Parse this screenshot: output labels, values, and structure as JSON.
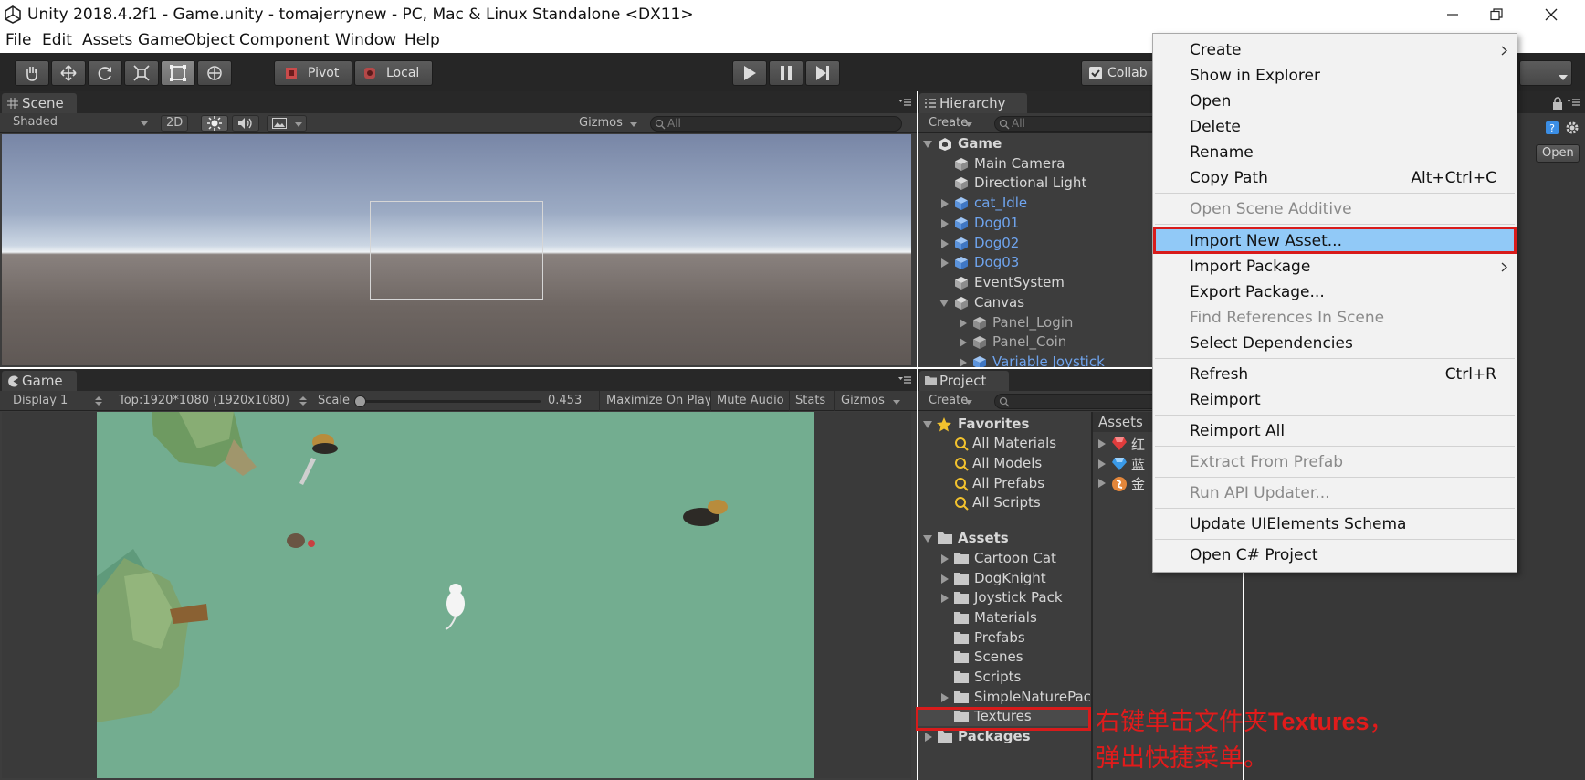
{
  "window": {
    "title": "Unity 2018.4.2f1 - Game.unity - tomajerrynew - PC, Mac & Linux Standalone <DX11>"
  },
  "menubar": [
    "File",
    "Edit",
    "Assets",
    "GameObject",
    "Component",
    "Window",
    "Help"
  ],
  "toolbar": {
    "pivot_label": "Pivot",
    "local_label": "Local",
    "collab_label": "Collab"
  },
  "scene": {
    "tab": "Scene",
    "shading": "Shaded",
    "mode_2d": "2D",
    "gizmos": "Gizmos",
    "search_placeholder": "All"
  },
  "game": {
    "tab": "Game",
    "display": "Display 1",
    "resolution": "Top:1920*1080 (1920x1080)",
    "scale_label": "Scale",
    "scale_value": "0.453",
    "maximize": "Maximize On Play",
    "mute": "Mute Audio",
    "stats": "Stats",
    "gizmos": "Gizmos"
  },
  "hierarchy": {
    "tab": "Hierarchy",
    "create": "Create",
    "search_placeholder": "All",
    "scene_name": "Game",
    "items": [
      {
        "label": "Main Camera"
      },
      {
        "label": "Directional Light"
      },
      {
        "label": "cat_Idle"
      },
      {
        "label": "Dog01"
      },
      {
        "label": "Dog02"
      },
      {
        "label": "Dog03"
      },
      {
        "label": "EventSystem"
      },
      {
        "label": "Canvas"
      },
      {
        "label": "Panel_Login"
      },
      {
        "label": "Panel_Coin"
      },
      {
        "label": "Variable Joystick"
      }
    ]
  },
  "project": {
    "tab": "Project",
    "create": "Create",
    "favorites_label": "Favorites",
    "favorites": [
      "All Materials",
      "All Models",
      "All Prefabs",
      "All Scripts"
    ],
    "assets_label": "Assets",
    "folders": [
      "Cartoon Cat",
      "DogKnight",
      "Joystick Pack",
      "Materials",
      "Prefabs",
      "Scenes",
      "Scripts",
      "SimpleNaturePac",
      "Textures"
    ],
    "packages_label": "Packages",
    "right_header": "Assets",
    "right_items": [
      "红",
      "蓝",
      "金"
    ]
  },
  "inspector": {
    "open_button": "Open"
  },
  "context_menu": {
    "items": [
      {
        "label": "Create",
        "shortcut": "",
        "submenu": true,
        "disabled": false
      },
      {
        "label": "Show in Explorer",
        "shortcut": "",
        "submenu": false,
        "disabled": false
      },
      {
        "label": "Open",
        "shortcut": "",
        "submenu": false,
        "disabled": false
      },
      {
        "label": "Delete",
        "shortcut": "",
        "submenu": false,
        "disabled": false
      },
      {
        "label": "Rename",
        "shortcut": "",
        "submenu": false,
        "disabled": false
      },
      {
        "label": "Copy Path",
        "shortcut": "Alt+Ctrl+C",
        "submenu": false,
        "disabled": false
      },
      {
        "label": "Open Scene Additive",
        "shortcut": "",
        "submenu": false,
        "disabled": true
      },
      {
        "label": "Import New Asset...",
        "shortcut": "",
        "submenu": false,
        "disabled": false,
        "highlighted": true
      },
      {
        "label": "Import Package",
        "shortcut": "",
        "submenu": true,
        "disabled": false
      },
      {
        "label": "Export Package...",
        "shortcut": "",
        "submenu": false,
        "disabled": false
      },
      {
        "label": "Find References In Scene",
        "shortcut": "",
        "submenu": false,
        "disabled": true
      },
      {
        "label": "Select Dependencies",
        "shortcut": "",
        "submenu": false,
        "disabled": false
      },
      {
        "label": "Refresh",
        "shortcut": "Ctrl+R",
        "submenu": false,
        "disabled": false
      },
      {
        "label": "Reimport",
        "shortcut": "",
        "submenu": false,
        "disabled": false
      },
      {
        "label": "Reimport All",
        "shortcut": "",
        "submenu": false,
        "disabled": false
      },
      {
        "label": "Extract From Prefab",
        "shortcut": "",
        "submenu": false,
        "disabled": true
      },
      {
        "label": "Run API Updater...",
        "shortcut": "",
        "submenu": false,
        "disabled": true
      },
      {
        "label": "Update UIElements Schema",
        "shortcut": "",
        "submenu": false,
        "disabled": false
      },
      {
        "label": "Open C# Project",
        "shortcut": "",
        "submenu": false,
        "disabled": false
      }
    ]
  },
  "annotation": {
    "line1_prefix": "右键单击文件夹",
    "line1_strong": "Textures",
    "line1_suffix": "，",
    "line2": "弹出快捷菜单。"
  },
  "colors": {
    "accent_red": "#e11b1b",
    "highlight_blue": "#91c9f7",
    "prefab_blue": "#6fa4ee",
    "panel_dark": "#3d3d3d"
  }
}
